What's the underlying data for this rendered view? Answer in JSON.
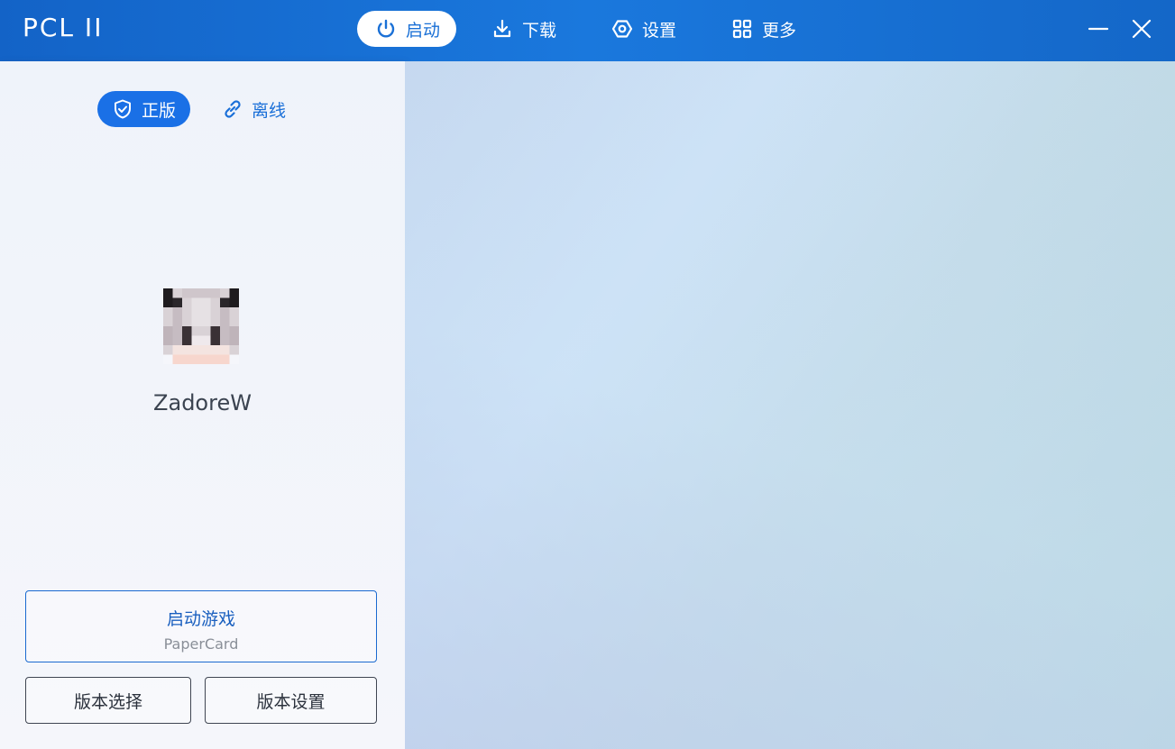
{
  "app": {
    "title": "PCL II"
  },
  "nav": [
    {
      "label": "启动",
      "icon": "power-icon",
      "active": true
    },
    {
      "label": "下载",
      "icon": "download-icon",
      "active": false
    },
    {
      "label": "设置",
      "icon": "settings-icon",
      "active": false
    },
    {
      "label": "更多",
      "icon": "grid-icon",
      "active": false
    }
  ],
  "window_controls": {
    "minimize": "minimize-icon",
    "close": "close-icon"
  },
  "account_modes": [
    {
      "label": "正版",
      "icon": "shield-check-icon",
      "active": true
    },
    {
      "label": "离线",
      "icon": "link-icon",
      "active": false
    }
  ],
  "user": {
    "name": "ZadoreW"
  },
  "launch": {
    "title": "启动游戏",
    "subtitle": "PaperCard"
  },
  "buttons": {
    "version_select": "版本选择",
    "version_settings": "版本设置"
  },
  "colors": {
    "titlebar": "#1a70d6",
    "accent": "#1a70e6",
    "panel": "#f2f4fa"
  }
}
